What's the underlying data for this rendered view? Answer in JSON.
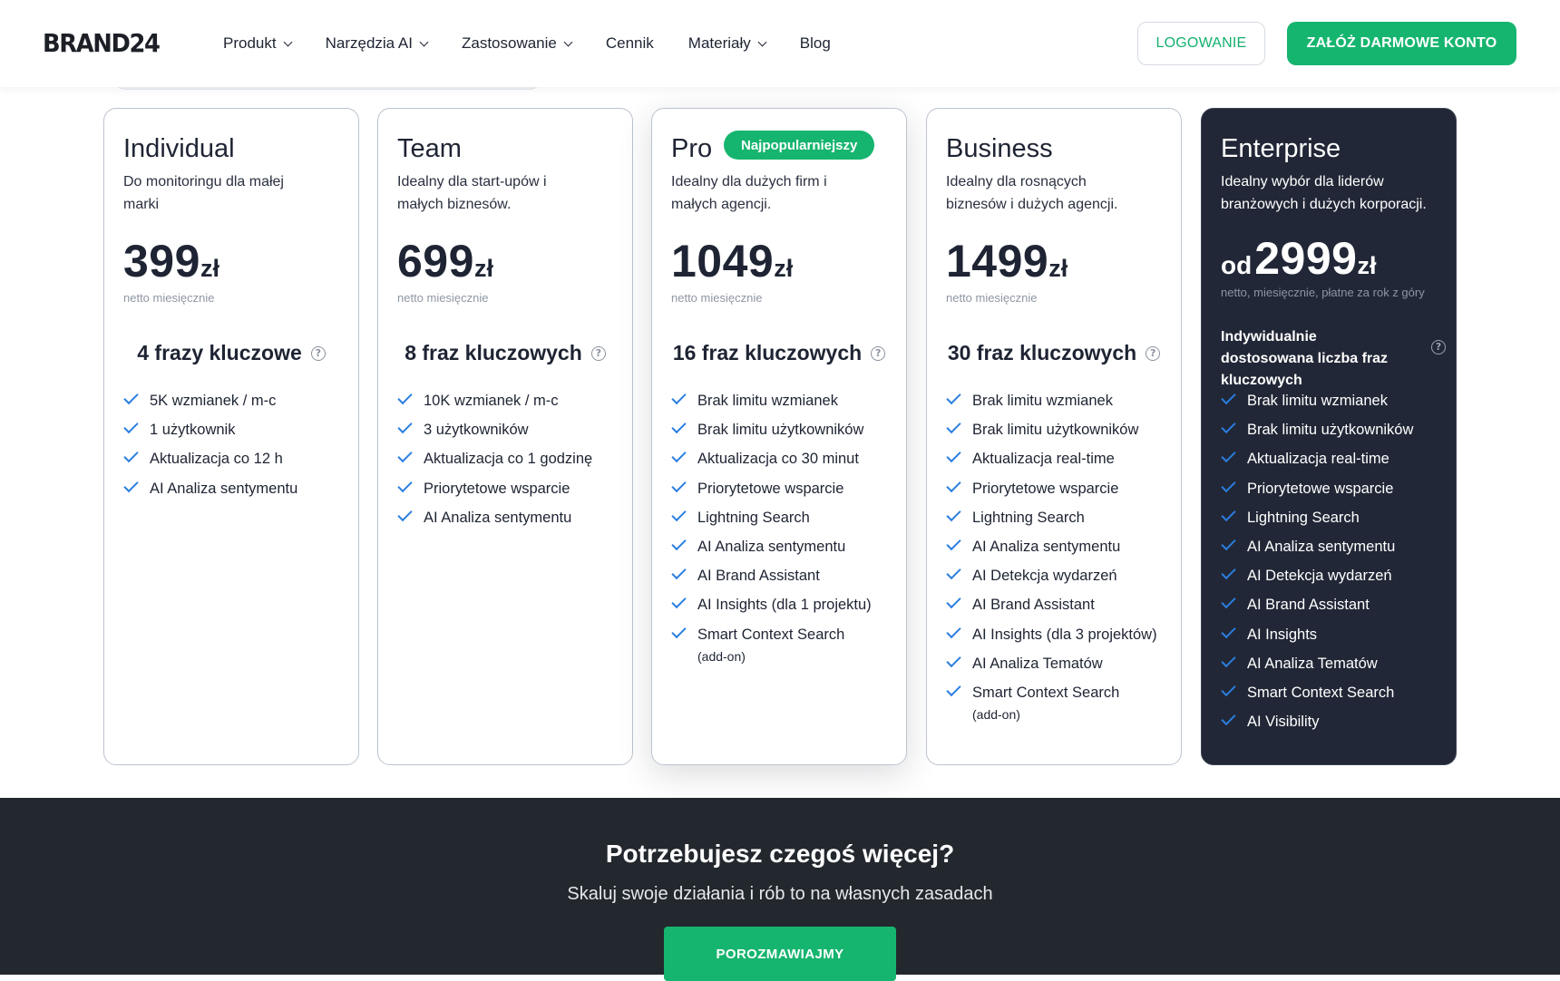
{
  "header": {
    "logo": "BRAND24",
    "nav": [
      {
        "label": "Produkt",
        "dropdown": true
      },
      {
        "label": "Narzędzia AI",
        "dropdown": true
      },
      {
        "label": "Zastosowanie",
        "dropdown": true
      },
      {
        "label": "Cennik",
        "dropdown": false
      },
      {
        "label": "Materiały",
        "dropdown": true
      },
      {
        "label": "Blog",
        "dropdown": false
      }
    ],
    "login_label": "LOGOWANIE",
    "register_label": "ZAŁÓŻ DARMOWE KONTO"
  },
  "plans": [
    {
      "name": "Individual",
      "description": "Do monitoringu dla małej marki",
      "price": "399",
      "currency": "zł",
      "price_note": "netto miesięcznie",
      "keywords": "4 frazy kluczowe",
      "features": [
        {
          "text": "5K wzmianek / m-c"
        },
        {
          "text": "1 użytkownik"
        },
        {
          "text": "Aktualizacja co 12 h"
        },
        {
          "text": "AI Analiza sentymentu"
        }
      ]
    },
    {
      "name": "Team",
      "description": "Idealny dla start-upów i małych biznesów.",
      "price": "699",
      "currency": "zł",
      "price_note": "netto miesięcznie",
      "keywords": "8 fraz kluczowych",
      "features": [
        {
          "text": "10K wzmianek / m-c"
        },
        {
          "text": "3 użytkowników"
        },
        {
          "text": "Aktualizacja co 1 godzinę"
        },
        {
          "text": "Priorytetowe wsparcie"
        },
        {
          "text": "AI Analiza sentymentu"
        }
      ]
    },
    {
      "name": "Pro",
      "badge": "Najpopularniejszy",
      "description": "Idealny dla dużych firm i małych agencji.",
      "price": "1049",
      "currency": "zł",
      "price_note": "netto miesięcznie",
      "keywords": "16 fraz kluczowych",
      "features": [
        {
          "text": "Brak limitu wzmianek"
        },
        {
          "text": "Brak limitu użytkowników"
        },
        {
          "text": "Aktualizacja co 30 minut"
        },
        {
          "text": "Priorytetowe wsparcie"
        },
        {
          "text": "Lightning Search"
        },
        {
          "text": "AI Analiza sentymentu"
        },
        {
          "text": "AI Brand Assistant"
        },
        {
          "text": "AI Insights (dla 1 projektu)"
        },
        {
          "text": "Smart Context Search",
          "sub": "(add-on)"
        }
      ]
    },
    {
      "name": "Business",
      "description": "Idealny dla rosnących biznesów i dużych agencji.",
      "price": "1499",
      "currency": "zł",
      "price_note": "netto miesięcznie",
      "keywords": "30 fraz kluczowych",
      "features": [
        {
          "text": "Brak limitu wzmianek"
        },
        {
          "text": "Brak limitu użytkowników"
        },
        {
          "text": "Aktualizacja real-time"
        },
        {
          "text": "Priorytetowe wsparcie"
        },
        {
          "text": "Lightning Search"
        },
        {
          "text": "AI Analiza sentymentu"
        },
        {
          "text": "AI Detekcja wydarzeń"
        },
        {
          "text": "AI Brand Assistant"
        },
        {
          "text": "AI Insights (dla 3 projektów)"
        },
        {
          "text": "AI Analiza Tematów"
        },
        {
          "text": "Smart Context Search",
          "sub": "(add-on)"
        }
      ]
    },
    {
      "name": "Enterprise",
      "description": "Idealny wybór dla liderów branżowych i dużych korporacji.",
      "price_prefix": "od",
      "price": "2999",
      "currency": "zł",
      "price_note": "netto, miesięcznie, płatne za rok z góry",
      "keywords": "Indywidualnie dostosowana liczba fraz kluczowych",
      "features": [
        {
          "text": "Brak limitu wzmianek"
        },
        {
          "text": "Brak limitu użytkowników"
        },
        {
          "text": "Aktualizacja real-time"
        },
        {
          "text": "Priorytetowe wsparcie"
        },
        {
          "text": "Lightning Search"
        },
        {
          "text": "AI Analiza sentymentu"
        },
        {
          "text": "AI Detekcja wydarzeń"
        },
        {
          "text": "AI Brand Assistant"
        },
        {
          "text": "AI Insights"
        },
        {
          "text": "AI Analiza Tematów"
        },
        {
          "text": "Smart Context Search"
        },
        {
          "text": "AI Visibility"
        }
      ]
    }
  ],
  "cta": {
    "title": "Potrzebujesz czegoś więcej?",
    "subtitle": "Skaluj swoje działania i rób to na własnych zasadach",
    "button_label": "POROZMAWIAJMY"
  },
  "colors": {
    "accent_green": "#16b56f",
    "check_blue": "#2a7ee0",
    "enterprise_bg": "#212736",
    "footer_bg": "#23282e"
  }
}
